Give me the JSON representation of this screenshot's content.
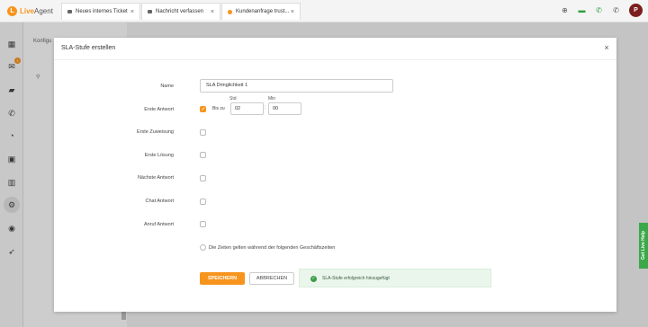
{
  "app": {
    "logo_text_1": "Live",
    "logo_text_2": "Agent",
    "logo_glyph": "L",
    "avatar_initial": "P"
  },
  "tabs": [
    {
      "label": "Neues internes Ticket",
      "icon": "ticket-icon"
    },
    {
      "label": "Nachricht verfassen",
      "icon": "mail-icon"
    },
    {
      "label": "Kundenanfrage trust...",
      "icon": "status-dot-icon"
    }
  ],
  "top_icons": [
    "add-circle-icon",
    "chat-icon",
    "phone-icon",
    "phone-icon"
  ],
  "left_nav": {
    "badge": "1",
    "icons": [
      "dashboard-icon",
      "tickets-icon",
      "chat-icon",
      "calls-icon",
      "reports-icon",
      "contacts-icon",
      "knowledgebase-icon",
      "settings-icon",
      "plugins-icon",
      "rocket-icon"
    ]
  },
  "sidebar": {
    "heading": "Konfigu",
    "search": "Q"
  },
  "modal": {
    "title": "SLA-Stufe erstellen",
    "close": "×",
    "fields": {
      "name_label": "Name",
      "name_value": "SLA Dringlichkeit 1",
      "first_answer_label": "Erste Antwort",
      "bis_zu": "Bis zu",
      "std_label": "Std",
      "min_label": "Min",
      "hours_value": "02",
      "minutes_value": "00",
      "first_assignment_label": "Erste Zuweisung",
      "first_solution_label": "Erste Lösung",
      "next_answer_label": "Nächste Antwort",
      "chat_answer_label": "Chat Antwort",
      "call_answer_label": "Anruf Antwort",
      "business_hours_text": "Die Zeiten gelten während der folgenden Geschäftszeiten"
    },
    "buttons": {
      "save": "SPEICHERN",
      "cancel": "ABBRECHEN"
    },
    "toast": "SLA-Stufe erfolgreich hinzugefügt"
  },
  "live_help": "Get Live Help",
  "colors": {
    "accent": "#f7941d",
    "success": "#3c9d4a",
    "live_help": "#3ba84a"
  }
}
